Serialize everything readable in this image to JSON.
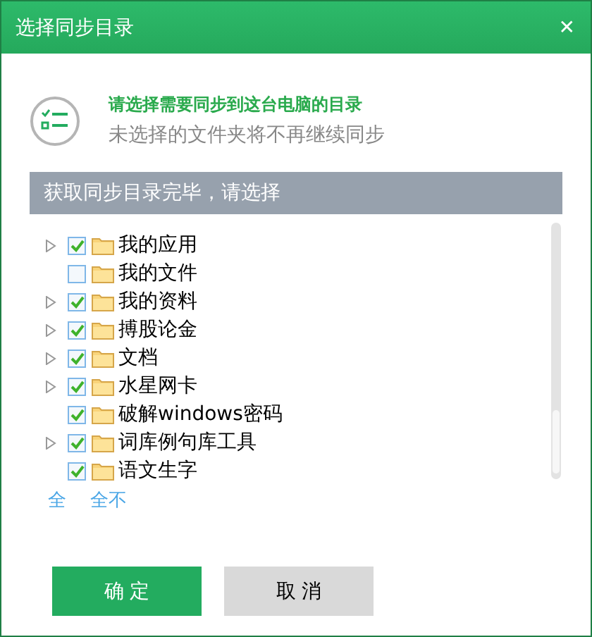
{
  "window": {
    "title": "选择同步目录",
    "close": "✕"
  },
  "header": {
    "prompt": "请选择需要同步到这台电脑的目录",
    "note": "未选择的文件夹将不再继续同步"
  },
  "status": "获取同步目录完毕，请选择",
  "folders": [
    {
      "name": "我的应用",
      "expandable": true,
      "checked": true
    },
    {
      "name": "我的文件",
      "expandable": false,
      "checked": false
    },
    {
      "name": "我的资料",
      "expandable": true,
      "checked": true
    },
    {
      "name": "搏股论金",
      "expandable": true,
      "checked": true
    },
    {
      "name": "文档",
      "expandable": true,
      "checked": true
    },
    {
      "name": "水星网卡",
      "expandable": true,
      "checked": true
    },
    {
      "name": "破解windows密码",
      "expandable": false,
      "checked": true
    },
    {
      "name": "词库例句库工具",
      "expandable": true,
      "checked": true
    },
    {
      "name": "语文生字",
      "expandable": false,
      "checked": true
    }
  ],
  "links": [
    "全",
    "全不"
  ],
  "buttons": [
    {
      "label": "确 定",
      "kind": "primary"
    },
    {
      "label": "取 消",
      "kind": "secondary"
    }
  ]
}
